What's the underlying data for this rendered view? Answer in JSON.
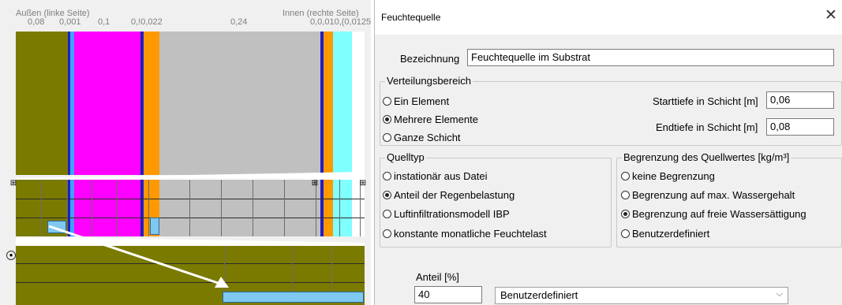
{
  "left_panel": {
    "outer_label": "Außen (linke Seite)",
    "inner_label": "Innen (rechte Seite)",
    "thickness_labels": [
      "0,08",
      "0,001",
      "0,1",
      "0,!0,022",
      "0,24",
      "0,0,010,(0,0125"
    ]
  },
  "dialog": {
    "title": "Feuchtequelle",
    "close_symbol": "✕",
    "bezeichnung": {
      "label": "Bezeichnung",
      "value": "Feuchtequelle im Substrat"
    },
    "verteilungsbereich": {
      "title": "Verteilungsbereich",
      "options": [
        {
          "label": "Ein Element",
          "checked": false
        },
        {
          "label": "Mehrere Elemente",
          "checked": true
        },
        {
          "label": "Ganze Schicht",
          "checked": false
        }
      ],
      "starttiefe_label": "Starttiefe in Schicht [m]",
      "starttiefe_value": "0,06",
      "endtiefe_label": "Endtiefe in Schicht [m]",
      "endtiefe_value": "0,08"
    },
    "quelltyp": {
      "title": "Quelltyp",
      "options": [
        {
          "label": "instationär aus Datei",
          "checked": false
        },
        {
          "label": "Anteil der Regenbelastung",
          "checked": true
        },
        {
          "label": "Luftinfiltrationsmodell IBP",
          "checked": false
        },
        {
          "label": "konstante monatliche Feuchtelast",
          "checked": false
        }
      ]
    },
    "begrenzung": {
      "title": "Begrenzung des Quellwertes [kg/m³]",
      "options": [
        {
          "label": "keine Begrenzung",
          "checked": false
        },
        {
          "label": "Begrenzung auf max. Wassergehalt",
          "checked": false
        },
        {
          "label": "Begrenzung auf freie Wassersättigung",
          "checked": true
        },
        {
          "label": "Benutzerdefiniert",
          "checked": false
        }
      ]
    },
    "anteil": {
      "label": "Anteil [%]",
      "value": "40"
    },
    "dropdown": {
      "selected": "Benutzerdefiniert",
      "arrow": "⌵"
    }
  },
  "colors": {
    "olive": "#7a7a00",
    "magenta": "#ff00ff",
    "orange": "#ff9900",
    "gray": "#c0c0c0",
    "blue": "#2020c0",
    "cyan": "#80ffff",
    "lightblue": "#7fc8f0",
    "arrow": "#ffffff"
  }
}
